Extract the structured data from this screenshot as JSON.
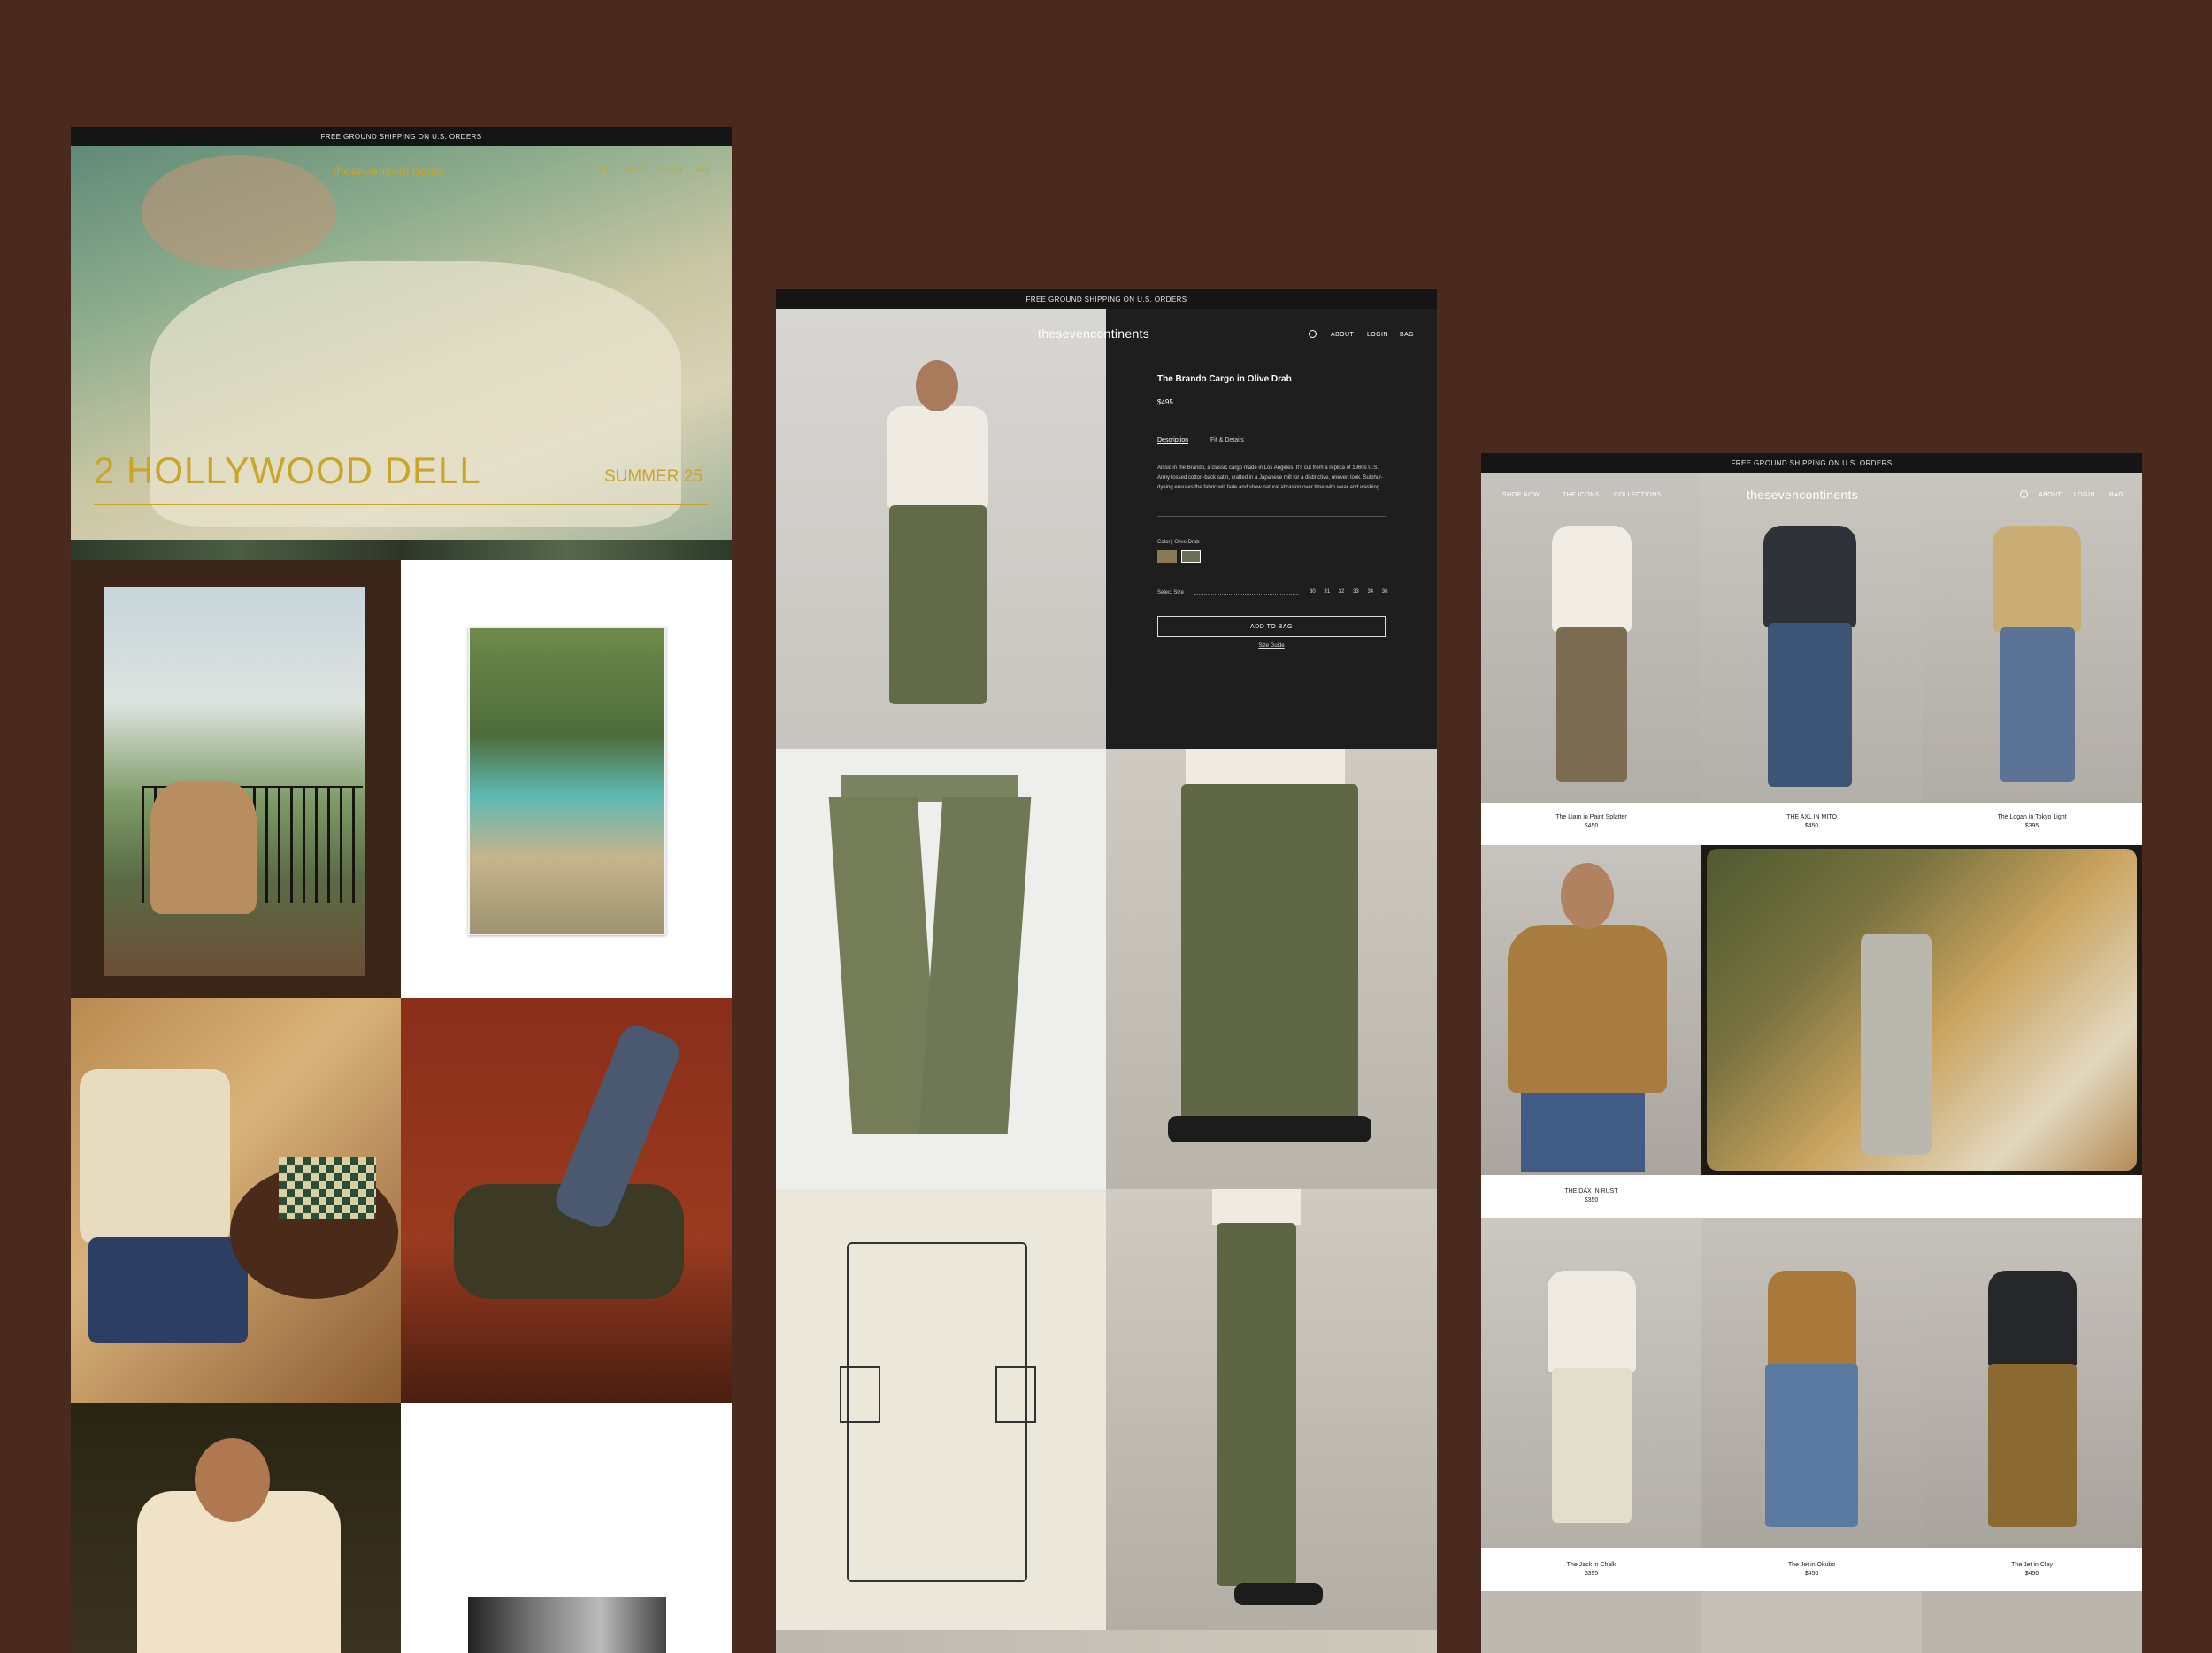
{
  "shipping": "FREE GROUND SHIPPING ON U.S. ORDERS",
  "brand": "thesevencontinents",
  "nav": {
    "shop_now": "SHOP NOW",
    "the_icons": "THE ICONS",
    "collections": "COLLECTIONS",
    "about": "ABOUT",
    "login": "LOGIN",
    "bag": "BAG"
  },
  "icons": {
    "search": "search-icon"
  },
  "hero": {
    "headline": "2 HOLLYWOOD DELL",
    "season": "SUMMER 25"
  },
  "product": {
    "title": "The Brando Cargo in Olive Drab",
    "price": "$495",
    "tabs": [
      "Description",
      "Fit & Details"
    ],
    "description": "Alssic in the Brando, a classic cargo made in Los Angeles. It's cut from a replica of 1960s U.S. Army tossed cotton-back satin, crafted in a Japanese mill for a distinctive, uneven look. Sulphur-dyeing ensures the fabric will fade and show natural abrasion over time with wear and washing.",
    "color_label": "Color",
    "color_value": "Olive Drab",
    "swatches": [
      "#8a7a55",
      "#6c6e55"
    ],
    "size_label": "Select Size",
    "sizes": [
      "30",
      "31",
      "32",
      "33",
      "34",
      "36"
    ],
    "add_to_bag": "ADD TO BAG",
    "size_guide": "Size Guide"
  },
  "grid": [
    {
      "name": "The Liam in Paint Splatter",
      "price": "$450"
    },
    {
      "name": "THE AXL IN MITO",
      "price": "$450"
    },
    {
      "name": "The Logan in Tokyo Light",
      "price": "$395"
    },
    {
      "name": "THE DAX IN RUST",
      "price": "$350"
    },
    {
      "name": "The Jack in Chalk",
      "price": "$395"
    },
    {
      "name": "The Jet in Okubo",
      "price": "$450"
    },
    {
      "name": "The Jet in Clay",
      "price": "$450"
    }
  ],
  "colors": {
    "background": "#4a2a1f",
    "dark": "#151515",
    "pdp_panel": "#1e1e1e",
    "gold_text": "#c9a52a",
    "olive": "#6b7350"
  }
}
